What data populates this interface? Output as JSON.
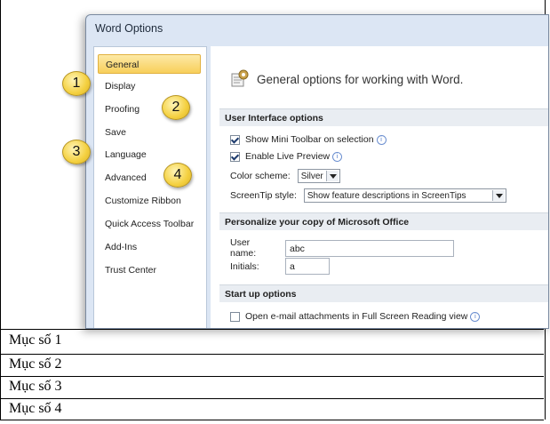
{
  "window": {
    "title": "Word Options",
    "header_text": "General options for working with Word."
  },
  "sidebar": {
    "items": [
      {
        "label": "General"
      },
      {
        "label": "Display"
      },
      {
        "label": "Proofing"
      },
      {
        "label": "Save"
      },
      {
        "label": "Language"
      },
      {
        "label": "Advanced"
      },
      {
        "label": "Customize Ribbon"
      },
      {
        "label": "Quick Access Toolbar"
      },
      {
        "label": "Add-Ins"
      },
      {
        "label": "Trust Center"
      }
    ]
  },
  "ui_options": {
    "section_title": "User Interface options",
    "mini_toolbar": "Show Mini Toolbar on selection",
    "live_preview": "Enable Live Preview",
    "color_scheme_label": "Color scheme:",
    "color_scheme_value": "Silver",
    "screentip_label": "ScreenTip style:",
    "screentip_value": "Show feature descriptions in ScreenTips"
  },
  "personalize": {
    "section_title": "Personalize your copy of Microsoft Office",
    "user_name_label": "User name:",
    "user_name_value": "abc",
    "initials_label": "Initials:",
    "initials_value": "a"
  },
  "startup": {
    "section_title": "Start up options",
    "open_attachments": "Open e-mail attachments in Full Screen Reading view"
  },
  "callouts": [
    "1",
    "2",
    "3",
    "4"
  ],
  "captions": [
    "Mục số 1",
    "Mục số 2",
    "Mục số 3",
    "Mục số 4"
  ]
}
